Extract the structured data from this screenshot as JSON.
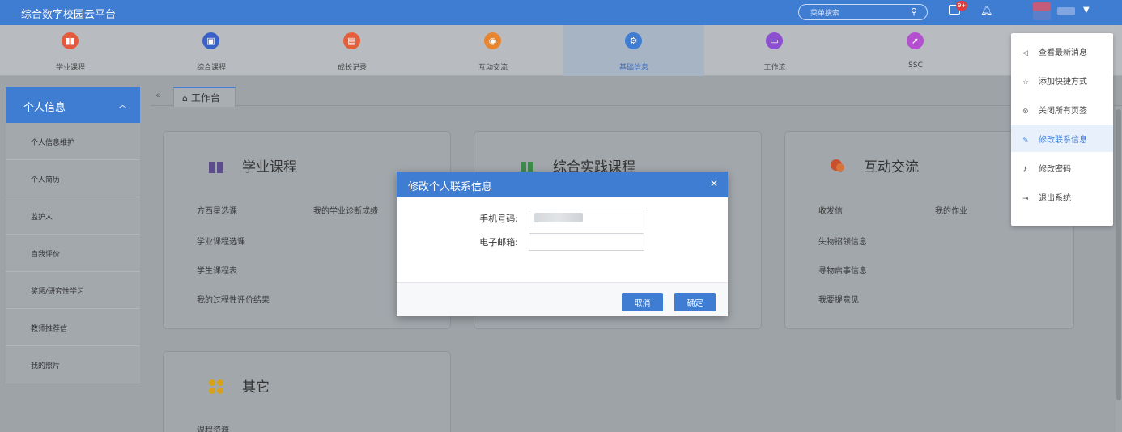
{
  "app": {
    "title": "综合数字校园云平台"
  },
  "header": {
    "search_placeholder": "菜单搜索",
    "msg_count": "9+"
  },
  "modules": [
    {
      "label": "学业课程",
      "color": "#e35a3f",
      "glyph": "▮▮",
      "active": false
    },
    {
      "label": "综合课程",
      "color": "#3a62c6",
      "glyph": "▣",
      "active": false
    },
    {
      "label": "成长记录",
      "color": "#e3603a",
      "glyph": "▤",
      "active": false
    },
    {
      "label": "互动交流",
      "color": "#e8852f",
      "glyph": "◉",
      "active": false
    },
    {
      "label": "基础信息",
      "color": "#3f7dd3",
      "glyph": "⚙",
      "active": true
    },
    {
      "label": "工作流",
      "color": "#8c4fd0",
      "glyph": "▭",
      "active": false
    },
    {
      "label": "SSC",
      "color": "#b44fcf",
      "glyph": "➚",
      "active": false
    }
  ],
  "sidebar": {
    "head": "个人信息",
    "items": [
      "个人信息维护",
      "个人简历",
      "监护人",
      "自我评价",
      "奖惩/研究性学习",
      "教师推荐信",
      "我的照片"
    ]
  },
  "tabs": {
    "home": "工作台"
  },
  "cards": {
    "academic": {
      "title": "学业课程",
      "links": [
        "方西星选课",
        "我的学业诊断成绩",
        "学业课程选课",
        "学生课程表",
        "我的过程性评价结果"
      ]
    },
    "practice": {
      "title": "综合实践课程"
    },
    "interact": {
      "title": "互动交流",
      "links": [
        "收发信",
        "我的作业",
        "失物招领信息",
        "寻物启事信息",
        "我要提意见"
      ]
    },
    "other": {
      "title": "其它",
      "links": [
        "课程资源"
      ]
    }
  },
  "dropdown": {
    "items": [
      {
        "label": "查看最新消息",
        "icon": "◁",
        "highlight": false
      },
      {
        "label": "添加快捷方式",
        "icon": "☆",
        "highlight": false
      },
      {
        "label": "关闭所有页签",
        "icon": "⊗",
        "highlight": false
      },
      {
        "label": "修改联系信息",
        "icon": "✎",
        "highlight": true
      },
      {
        "label": "修改密码",
        "icon": "⚷",
        "highlight": false
      },
      {
        "label": "退出系统",
        "icon": "⇥",
        "highlight": false
      }
    ]
  },
  "modal": {
    "title": "修改个人联系信息",
    "phone_label": "手机号码:",
    "email_label": "电子邮箱:",
    "email_value": "",
    "cancel_label": "取消",
    "ok_label": "确定"
  }
}
